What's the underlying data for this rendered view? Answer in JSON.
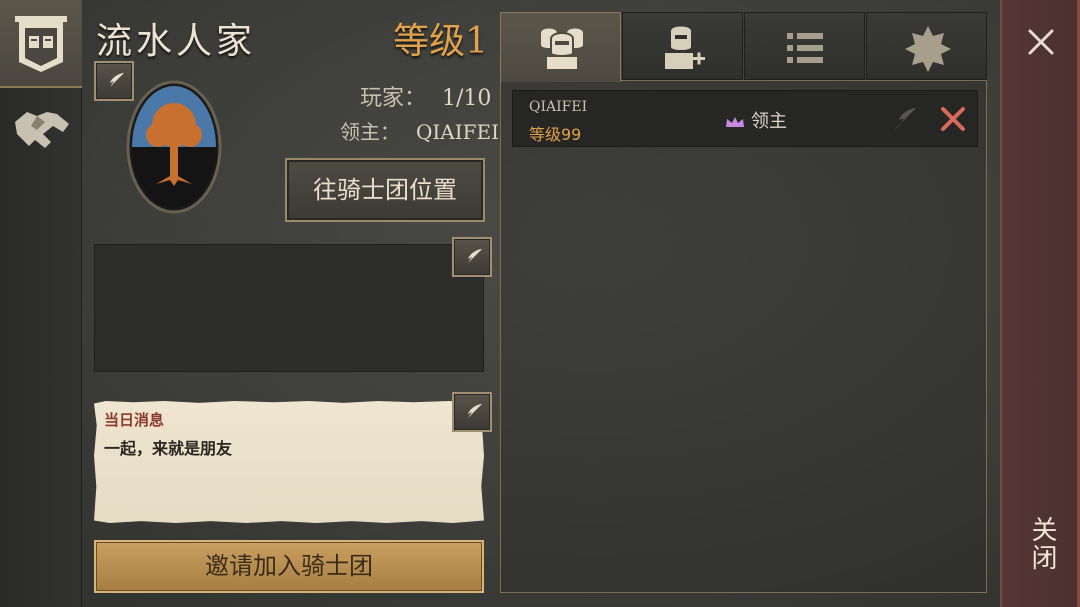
{
  "guild": {
    "name": "流水人家",
    "level": "等级1",
    "players_label": "玩家：",
    "players_value": "1/10",
    "lord_label": "领主：",
    "lord_value": "QIAIFEI",
    "goto_button": "往骑士团位置",
    "daily_title": "当日消息",
    "daily_text": "一起，来就是朋友",
    "invite_button": "邀请加入骑士团"
  },
  "left_tabs": [
    {
      "icon": "guild-banner-icon",
      "active": true
    },
    {
      "icon": "handshake-icon",
      "active": false
    }
  ],
  "tabs": [
    {
      "icon": "members-icon",
      "active": true
    },
    {
      "icon": "add-member-icon",
      "active": false
    },
    {
      "icon": "list-icon",
      "active": false
    },
    {
      "icon": "badge-icon",
      "active": false
    }
  ],
  "members": [
    {
      "name": "QIAIFEI",
      "level": "等级99",
      "role": "领主"
    }
  ],
  "close": {
    "label": "关闭"
  },
  "colors": {
    "accent_gold": "#e0a24a",
    "close_bar": "#563836",
    "role_crown": "#c88ae0"
  }
}
